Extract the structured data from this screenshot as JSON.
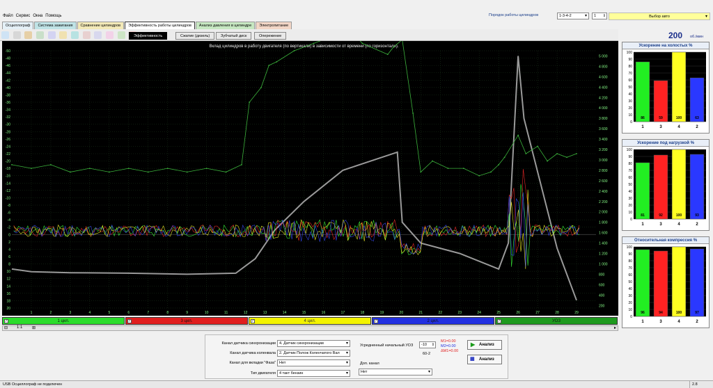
{
  "menu": [
    "Файл",
    "Сервис",
    "Окна",
    "Помощь"
  ],
  "top_right": {
    "order_label": "Порядок работы цилиндров",
    "order_value": "1-3-4-2",
    "cyl_value": "1",
    "auto_button": "Выбор авто"
  },
  "tabs": [
    {
      "label": "Осциллограф",
      "color": "#e4f0f7"
    },
    {
      "label": "Система зажигания",
      "color": "#bfe3e6"
    },
    {
      "label": "Сравнение цилиндров",
      "color": "#f3e9b7"
    },
    {
      "label": "Эффективность работы цилиндров",
      "color": "#ffffff"
    },
    {
      "label": "Анализ давления в цилиндре",
      "color": "#c6e7c1"
    },
    {
      "label": "Электропитание",
      "color": "#f2d6c6"
    }
  ],
  "subtabs": [
    "Эффективность",
    "Сжатие (дизель)",
    "Зубчатый диск",
    "Опережение"
  ],
  "rpm": {
    "value": "200",
    "unit": "об./мин"
  },
  "chart_data": {
    "type": "line",
    "title": "Вклад цилиндров в работу двигателя (по вертикали) в зависимости от времени (по горизонтали).",
    "x_ticks": [
      "1",
      "2",
      "3",
      "4",
      "5",
      "6",
      "7",
      "8",
      "9",
      "10",
      "11",
      "12",
      "13",
      "14",
      "15",
      "16",
      "17",
      "18",
      "19",
      "20",
      "21",
      "22",
      "23",
      "24",
      "25",
      "26",
      "27",
      "28",
      "29"
    ],
    "y_left_ticks": [
      "-50",
      "-48",
      "-46",
      "-44",
      "-42",
      "-40",
      "-38",
      "-36",
      "-34",
      "-32",
      "-30",
      "-28",
      "-26",
      "-24",
      "-22",
      "-20",
      "-18",
      "-16",
      "-14",
      "-12",
      "-10",
      "-8",
      "-6",
      "-4",
      "-2",
      "0",
      "2",
      "4",
      "6",
      "8",
      "10",
      "12",
      "14",
      "16",
      "18",
      "20"
    ],
    "y_right_ticks": [
      "5 000",
      "4 800",
      "4 600",
      "4 400",
      "4 200",
      "4 000",
      "3 800",
      "3 600",
      "3 400",
      "3 200",
      "3 000",
      "2 800",
      "2 600",
      "2 400",
      "2 200",
      "2 000",
      "1 800",
      "1 600",
      "1 400",
      "1 200",
      "1 000",
      "800",
      "600",
      "400",
      "200"
    ],
    "ylim_left": [
      -50,
      20
    ],
    "ylim_right": [
      5100,
      150
    ],
    "xlim": [
      0,
      30
    ],
    "series": [
      {
        "name": "1 цил.",
        "color": "#3cff3c"
      },
      {
        "name": "3 цил.",
        "color": "#ff2a2a"
      },
      {
        "name": "4 цил.",
        "color": "#ffff2a"
      },
      {
        "name": "2 цил.",
        "color": "#3a4dff"
      },
      {
        "name": "УОЗ",
        "color": "#3cb43c"
      }
    ],
    "rpm_trace": {
      "x": [
        0,
        1,
        3,
        6,
        9,
        11.5,
        12.5,
        13.5,
        15,
        17,
        19.8,
        20.05,
        21,
        23,
        25,
        25.5,
        26,
        26.3,
        28,
        29
      ],
      "y": [
        900,
        850,
        830,
        820,
        800,
        820,
        1100,
        1650,
        2200,
        2800,
        3150,
        1800,
        1400,
        1200,
        900,
        1400,
        5000,
        3800,
        1300,
        300
      ]
    },
    "timing_trace": {
      "x": [
        0,
        1,
        2,
        3,
        4,
        5,
        6,
        7,
        8,
        9,
        10,
        11,
        11.8,
        12.2,
        12.8,
        13.2,
        13.6,
        14.5,
        15.5,
        16.5,
        17.5,
        18,
        19.3,
        19.6,
        20.05,
        20.6,
        21,
        21.6,
        22.4,
        23.2,
        24,
        24.6,
        25,
        25.3,
        26,
        26.4,
        27,
        27.5,
        28,
        28.5,
        29
      ],
      "y": [
        -19,
        -18,
        -19,
        -17,
        -18,
        -17,
        -18,
        -17,
        -18,
        -17,
        -18,
        -17,
        -19,
        -36,
        -40,
        -46,
        -47,
        -50,
        -52,
        -54,
        -55,
        -52,
        -49,
        -51,
        -53,
        -33,
        -17,
        -20,
        -18,
        -18,
        -16,
        -17,
        -19,
        -21,
        -27,
        -22,
        -24,
        -20,
        -22,
        -21,
        -22
      ]
    },
    "cyl_baseline": -1
  },
  "legend": [
    {
      "label": "1 цил.",
      "color": "#2bdc2b"
    },
    {
      "label": "3 цил.",
      "color": "#e01e1e"
    },
    {
      "label": "4 цил.",
      "color": "#f3f300"
    },
    {
      "label": "2 цил.",
      "color": "#2230e0"
    },
    {
      "label": "УОЗ",
      "color": "#1e9a1e"
    }
  ],
  "zoom": "1:1",
  "bar_panels": [
    {
      "title": "Ускорение на холостых %",
      "labels": [
        "1",
        "3",
        "4",
        "2"
      ],
      "values": [
        86,
        59,
        100,
        63
      ]
    },
    {
      "title": "Ускорение под нагрузкой %",
      "labels": [
        "1",
        "3",
        "4",
        "2"
      ],
      "values": [
        81,
        92,
        100,
        93
      ]
    },
    {
      "title": "Относительная компрессия %",
      "labels": [
        "1",
        "3",
        "4",
        "2"
      ],
      "values": [
        96,
        94,
        100,
        97
      ]
    }
  ],
  "bar_colors": [
    "#22ee22",
    "#ff2222",
    "#ffff22",
    "#2a38ff"
  ],
  "bar_axis_ticks": [
    "100",
    "90",
    "80",
    "70",
    "60",
    "50",
    "40",
    "30",
    "20",
    "10",
    "0"
  ],
  "controls": {
    "sync_label": "Канал датчика синхронизации",
    "sync_value": "4. Датчик синхронизации",
    "crank_label": "Канал датчика коленвала",
    "crank_value": "2. Датчик Полож Коленчатого Вал",
    "phase_label": "Канал для вкладки \"Фаза\"",
    "phase_value": "Нет",
    "engine_label": "Тип двигателя",
    "engine_value": "4 такт бензин",
    "uoz_label": "Усредненный начальный УОЗ",
    "uoz_value": "-10",
    "wheel_value": "60-2",
    "extra_label": "Доп. канал",
    "extra_value": "Нет",
    "m1": "M1=0.00",
    "m2": "M2=0.00",
    "dm": "ΔM1=0.00",
    "analyze1": "Анализ",
    "analyze2": "Анализ"
  },
  "status": {
    "left": "USB Осциллограф не подключен",
    "right": "2.8"
  }
}
